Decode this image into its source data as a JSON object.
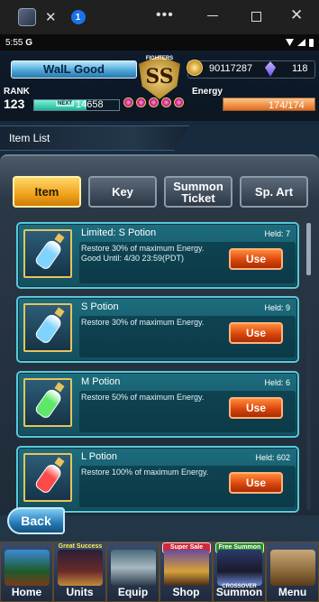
{
  "window": {
    "tab_badge": "1",
    "more_label": "•••",
    "close_symbol": "✕",
    "tab_close_symbol": "✕"
  },
  "status_bar": {
    "time": "5:55",
    "g_label": "G"
  },
  "header": {
    "player_name": "WalL Good",
    "rank_label": "RANK",
    "rank": "123",
    "next_label": "NEXT",
    "xp_to_next": "14658",
    "xp_progress": 0.62,
    "emblem_text": "SS",
    "emblem_banner": "FIGHTERS",
    "gil": "90117287",
    "lapis": "118",
    "energy_label": "Energy",
    "energy": "174/174",
    "energy_fraction": 1.0
  },
  "title": "Item List",
  "tabs": [
    {
      "label": "Item",
      "active": true
    },
    {
      "label": "Key",
      "active": false
    },
    {
      "label": "Summon Ticket",
      "active": false
    },
    {
      "label": "Sp. Art",
      "active": false
    }
  ],
  "items": [
    {
      "name": "Limited: S Potion",
      "held": "Held: 7",
      "description": "Restore 30% of maximum Energy. Good Until: 4/30 23:59(PDT)",
      "use_label": "Use",
      "potion_color": "#7fd3ff"
    },
    {
      "name": "S Potion",
      "held": "Held: 9",
      "description": "Restore 30% of maximum Energy.",
      "use_label": "Use",
      "potion_color": "#7fd3ff"
    },
    {
      "name": "M Potion",
      "held": "Held: 6",
      "description": "Restore 50% of maximum Energy.",
      "use_label": "Use",
      "potion_color": "#5ee86a"
    },
    {
      "name": "L Potion",
      "held": "Held: 602",
      "description": "Restore 100% of maximum Energy.",
      "use_label": "Use",
      "potion_color": "#ff4a4a"
    }
  ],
  "back_label": "Back",
  "nav": [
    {
      "label": "Home",
      "tag": "",
      "sub": ""
    },
    {
      "label": "Units",
      "tag": "Great Success Rate UP",
      "sub": ""
    },
    {
      "label": "Equip",
      "tag": "",
      "sub": ""
    },
    {
      "label": "Shop",
      "tag": "Super Sale",
      "sub": ""
    },
    {
      "label": "Summon",
      "tag": "Free Summon",
      "sub": "CROSSOVER"
    },
    {
      "label": "Menu",
      "tag": "",
      "sub": ""
    }
  ],
  "colors": {
    "active_tab": "#f0a21a",
    "use_button": "#d6420a",
    "item_border": "#58c9db",
    "back_button": "#2579b6"
  }
}
